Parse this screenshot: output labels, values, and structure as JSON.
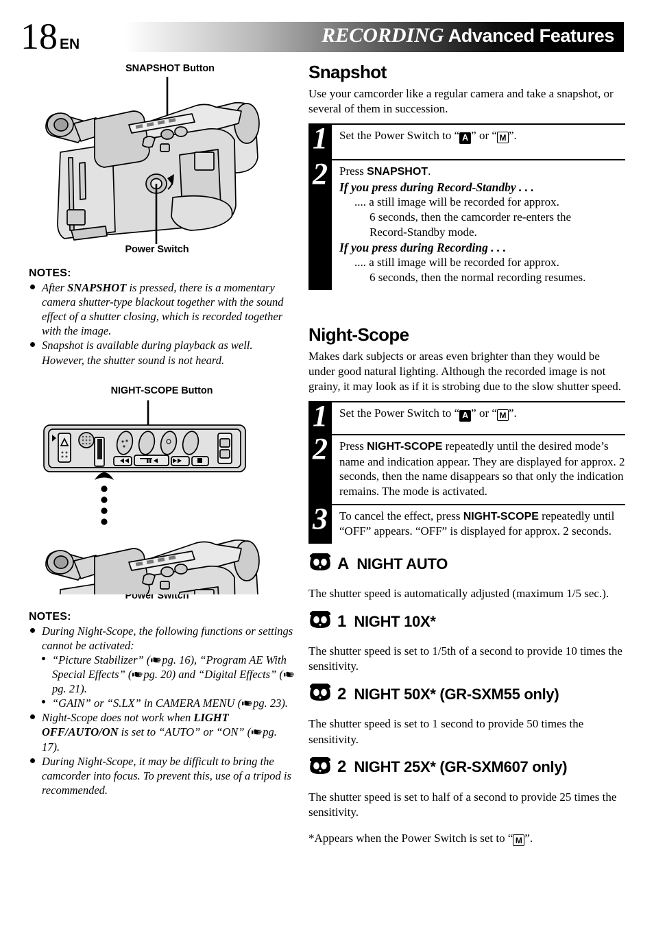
{
  "header": {
    "page_number": "18",
    "language_code": "EN",
    "title_italic": "RECORDING",
    "title_bold": "Advanced Features"
  },
  "left_column": {
    "figure_1": {
      "caption_top": "SNAPSHOT Button",
      "caption_bottom": "Power Switch",
      "alt": "camcorder-rear-three-quarter-view"
    },
    "notes_1": {
      "title": "NOTES:",
      "items": [
        "After SNAPSHOT is pressed, there is a momentary camera shutter-type blackout together with the sound effect of a shutter closing, which is recorded together with the image.",
        "Snapshot is available during playback as well. However, the shutter sound is not heard."
      ]
    },
    "figure_2": {
      "caption_top": "NIGHT-SCOPE Button",
      "caption_bottom": "Power Switch",
      "alt": "camcorder-control-panel-and-body"
    },
    "notes_2": {
      "title": "NOTES:",
      "item1_lead": "During Night-Scope, the following functions or settings cannot be activated:",
      "item1_sub1_a": "“Picture Stabilizer” (",
      "item1_sub1_pg1": "pg. 16), “Program AE With Special Effects” (",
      "item1_sub1_pg2": "pg. 20) and “Digital Effects” (",
      "item1_sub1_pg3": "pg. 21).",
      "item1_sub2_a": "“GAIN” or “S.LX” in CAMERA MENU (",
      "item1_sub2_pg": "pg. 23).",
      "item2_a": "Night-Scope does not work when ",
      "item2_b": "LIGHT OFF/AUTO/ON",
      "item2_c": " is set to “AUTO” or “ON” (",
      "item2_pg": "pg. 17).",
      "item3": "During Night-Scope, it may be difficult to bring the camcorder into focus. To prevent this, use of a tripod is recommended."
    }
  },
  "right_column": {
    "snapshot": {
      "heading": "Snapshot",
      "intro": "Use your camcorder like a regular camera and take a snapshot, or several of them in succession.",
      "steps": [
        {
          "number": "1",
          "line_a": "Set the Power Switch to “",
          "glyph_a": "A",
          "line_b": "” or “",
          "glyph_b": "M",
          "line_c": "”."
        },
        {
          "number": "2",
          "press_label_a": "Press ",
          "press_label_b": "SNAPSHOT",
          "press_label_c": ".",
          "sub1_head": "If you press during Record-Standby . . .",
          "sub1_l1": ".... a still image will be recorded for approx.",
          "sub1_l2": "6 seconds, then the camcorder re-enters the",
          "sub1_l3": "Record-Standby mode.",
          "sub2_head": "If you press during Recording . . .",
          "sub2_l1": ".... a still image will be recorded for approx.",
          "sub2_l2": "6 seconds, then the normal recording resumes."
        }
      ]
    },
    "nightscope": {
      "heading": "Night-Scope",
      "intro": "Makes dark subjects or areas even brighter than they would be under good natural lighting. Although the recorded image is not grainy, it may look as if it is strobing due to the slow shutter speed.",
      "steps": [
        {
          "number": "1",
          "line_a": "Set the Power Switch to “",
          "glyph_a": "A",
          "line_b": "” or “",
          "glyph_b": "M",
          "line_c": "”."
        },
        {
          "number": "2",
          "text_a": "Press ",
          "text_b": "NIGHT-SCOPE",
          "text_c": " repeatedly until the desired mode’s name and indication appear. They are displayed for approx. 2 seconds, then the name disappears so that only the indication remains. The mode is activated."
        },
        {
          "number": "3",
          "text_a": "To cancel the effect, press ",
          "text_b": "NIGHT-SCOPE",
          "text_c": " repeatedly until “OFF” appears. “OFF” is displayed for approx. 2 seconds."
        }
      ],
      "modes": [
        {
          "icon": "owl-icon",
          "indicator": "A",
          "label": "NIGHT AUTO",
          "description": "The shutter speed is automatically adjusted (maximum 1/5 sec.)."
        },
        {
          "icon": "owl-icon",
          "indicator": "1",
          "label": "NIGHT 10X*",
          "description": "The shutter speed is set to 1/5th of a second to provide 10 times the sensitivity."
        },
        {
          "icon": "owl-icon",
          "indicator": "2",
          "label": "NIGHT 50X* (GR-SXM55 only)",
          "description": "The shutter speed is set to 1 second to provide 50 times the sensitivity."
        },
        {
          "icon": "owl-icon",
          "indicator": "2",
          "label": "NIGHT 25X* (GR-SXM607 only)",
          "description": "The shutter speed is set to half of a second to provide 25 times the sensitivity."
        }
      ],
      "footnote_a": "*Appears when the Power Switch is set to “",
      "footnote_glyph": "M",
      "footnote_b": "”."
    }
  },
  "colors": {
    "ink": "#000000",
    "paper": "#ffffff",
    "illustration_fill": "#d9d9d9",
    "illustration_fill_light": "#eeeeee"
  }
}
